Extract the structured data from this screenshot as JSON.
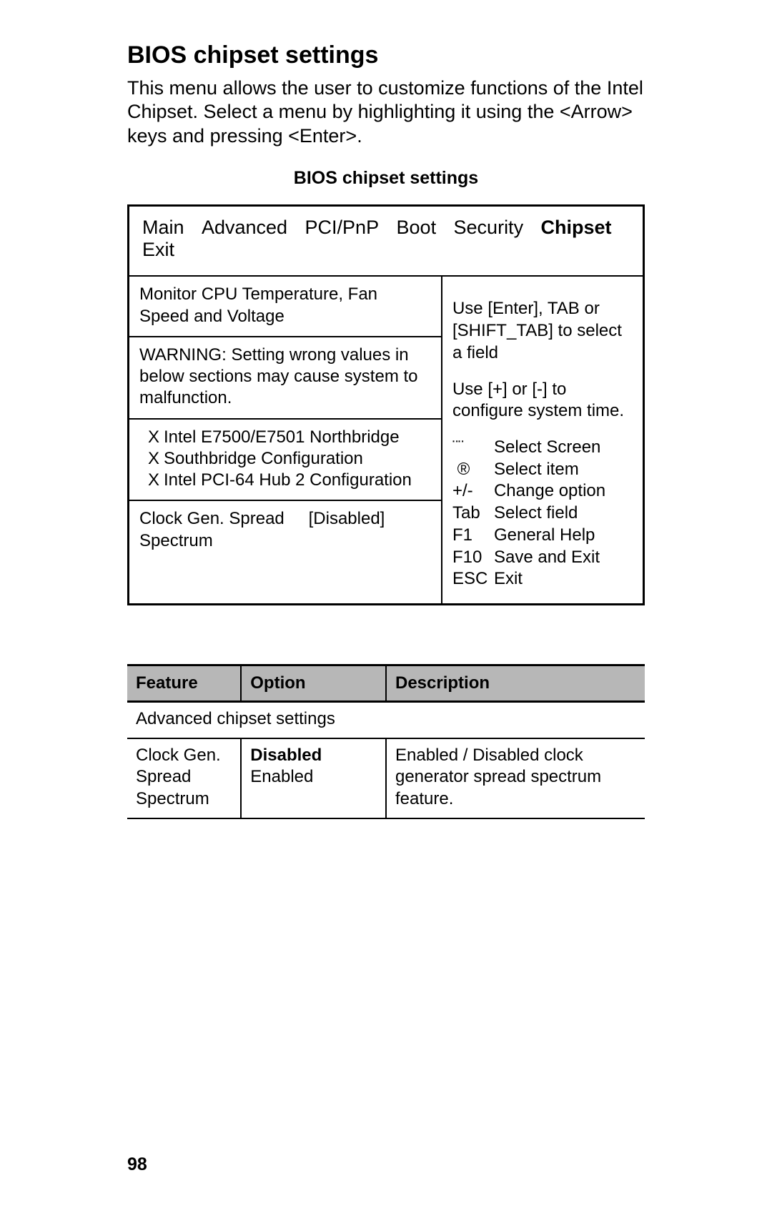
{
  "page_number": "98",
  "heading": "BIOS chipset settings",
  "intro": "This menu allows the user to customize functions of the Intel Chipset. Select a menu by highlighting it using the <Arrow> keys and pressing <Enter>.",
  "caption": "BIOS chipset settings",
  "bios": {
    "tabs": [
      "Main",
      "Advanced",
      "PCI/PnP",
      "Boot",
      "Security",
      "Chipset",
      "Exit"
    ],
    "active_tab_index": 5,
    "left": {
      "block1": "Monitor CPU Temperature, Fan Speed and Voltage",
      "block2": "WARNING: Setting wrong values in below sections may cause system to malfunction.",
      "submenu_prefix": "X",
      "submenus": [
        "Intel E7500/E7501 Northbridge",
        "Southbridge Configuration",
        "Intel PCI-64 Hub 2 Configuration"
      ],
      "setting_label": "Clock Gen. Spread Spectrum",
      "setting_value": "[Disabled]"
    },
    "right": {
      "hint1": "Use [Enter], TAB or [SHIFT_TAB] to select a field",
      "hint2": "Use [+] or [-] to configure system time.",
      "legend": [
        {
          "sym": "¨¨",
          "txt": "Select Screen"
        },
        {
          "sym": "­ ® ",
          "txt": "Select item"
        },
        {
          "sym": "+/-",
          "txt": "Change option"
        },
        {
          "sym": "Tab",
          "txt": "Select field"
        },
        {
          "sym": "F1",
          "txt": "General Help"
        },
        {
          "sym": "F10",
          "txt": "Save and Exit"
        },
        {
          "sym": "ESC",
          "txt": "Exit"
        }
      ]
    }
  },
  "table": {
    "headers": {
      "feature": "Feature",
      "option": "Option",
      "description": "Description"
    },
    "group_row": "Advanced chipset settings",
    "row1": {
      "feature": "Clock Gen. Spread Spectrum",
      "option_bold": "Disabled",
      "option_rest": "Enabled",
      "description": "Enabled / Disabled clock generator spread spectrum feature."
    }
  }
}
